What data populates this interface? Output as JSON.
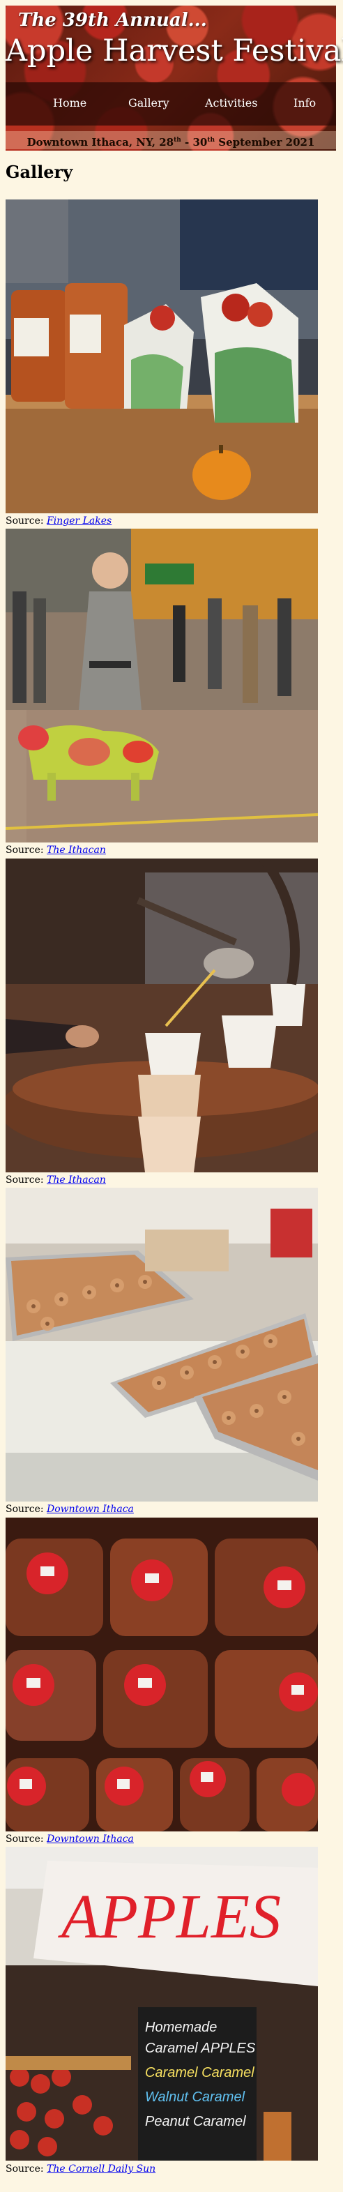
{
  "banner": {
    "subtitle": "The 39th Annual...",
    "title": "Apple Harvest Festival",
    "date_prefix": "Downtown Ithaca, NY, 28",
    "date_sup1": "th",
    "date_mid": " - 30",
    "date_sup2": "th",
    "date_suffix": " September 2021"
  },
  "nav": {
    "items": [
      {
        "label": "Home"
      },
      {
        "label": "Gallery"
      },
      {
        "label": "Activities"
      },
      {
        "label": "Info"
      }
    ]
  },
  "page": {
    "heading": "Gallery"
  },
  "gallery": {
    "source_label": "Source:",
    "items": [
      {
        "source": "Finger Lakes",
        "image": "cider-jugs-and-apple-bags"
      },
      {
        "source": "The Ithacan",
        "image": "woman-with-decorated-dog"
      },
      {
        "source": "The Ithacan",
        "image": "ladle-pouring-cider"
      },
      {
        "source": "Downtown Ithaca",
        "image": "cider-donut-trays"
      },
      {
        "source": "Downtown Ithaca",
        "image": "cider-gallon-jugs"
      },
      {
        "source": "The Cornell Daily Sun",
        "image": "apples-stand-sign",
        "sign_text": "APPLES",
        "chalkboard_lines": [
          "Homemade",
          "Caramel APPLES",
          "Caramel Caramel",
          "Walnut Caramel",
          "Peanut Caramel"
        ]
      }
    ]
  },
  "colors": {
    "background": "#fdf6e3",
    "banner": "#8a2a18",
    "link": "#0000ee"
  }
}
